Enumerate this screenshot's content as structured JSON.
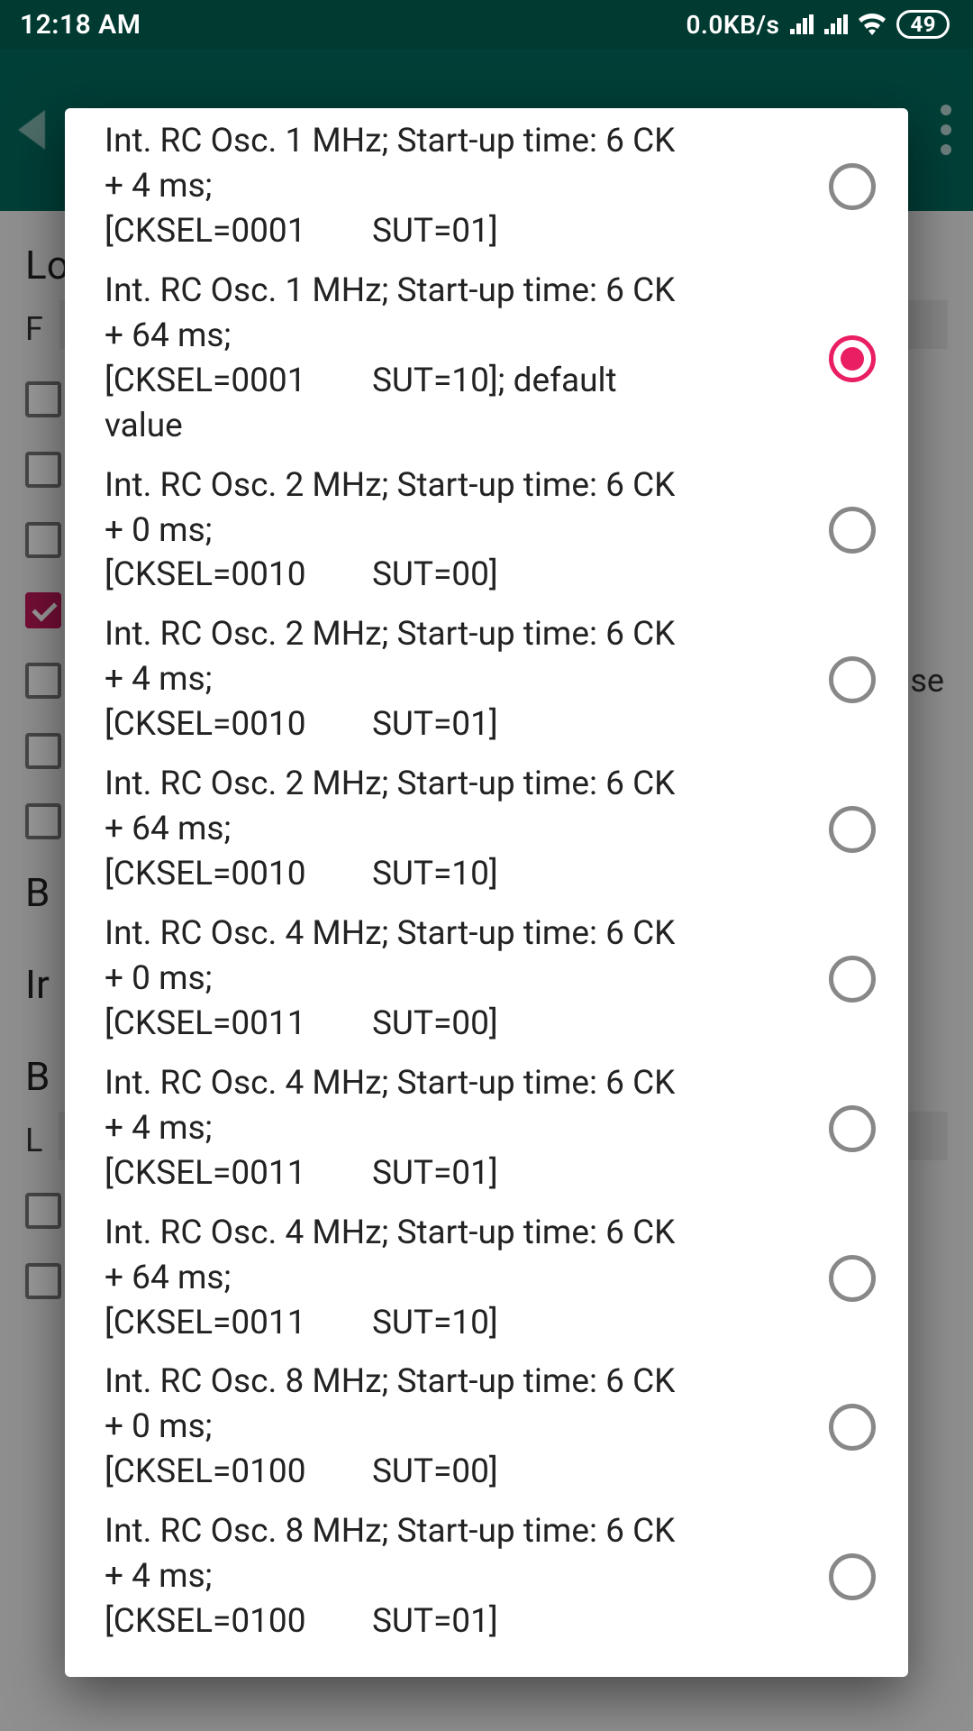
{
  "status_bar": {
    "time": "12:18 AM",
    "net_speed": "0.0KB/s",
    "battery": "49"
  },
  "background": {
    "heading1": "Lo",
    "field1_label": "F",
    "checks": [
      false,
      false,
      false,
      true,
      false,
      false,
      false
    ],
    "right_fragment": "se",
    "heading2": "B",
    "heading3": "Ir",
    "heading4": "B",
    "heading5": "L"
  },
  "dialog": {
    "selected_index": 1,
    "options": [
      "Int. RC Osc. 1 MHz; Start-up time: 6 CK\n+ 4 ms;\n[CKSEL=0001        SUT=01]",
      "Int. RC Osc. 1 MHz; Start-up time: 6 CK\n+ 64 ms;\n[CKSEL=0001        SUT=10]; default\nvalue",
      "Int. RC Osc. 2 MHz; Start-up time: 6 CK\n+ 0 ms;\n[CKSEL=0010        SUT=00]",
      "Int. RC Osc. 2 MHz; Start-up time: 6 CK\n+ 4 ms;\n[CKSEL=0010        SUT=01]",
      "Int. RC Osc. 2 MHz; Start-up time: 6 CK\n+ 64 ms;\n[CKSEL=0010        SUT=10]",
      "Int. RC Osc. 4 MHz; Start-up time: 6 CK\n+ 0 ms;\n[CKSEL=0011        SUT=00]",
      "Int. RC Osc. 4 MHz; Start-up time: 6 CK\n+ 4 ms;\n[CKSEL=0011        SUT=01]",
      "Int. RC Osc. 4 MHz; Start-up time: 6 CK\n+ 64 ms;\n[CKSEL=0011        SUT=10]",
      "Int. RC Osc. 8 MHz; Start-up time: 6 CK\n+ 0 ms;\n[CKSEL=0100        SUT=00]",
      "Int. RC Osc. 8 MHz; Start-up time: 6 CK\n+ 4 ms;\n[CKSEL=0100        SUT=01]"
    ]
  }
}
